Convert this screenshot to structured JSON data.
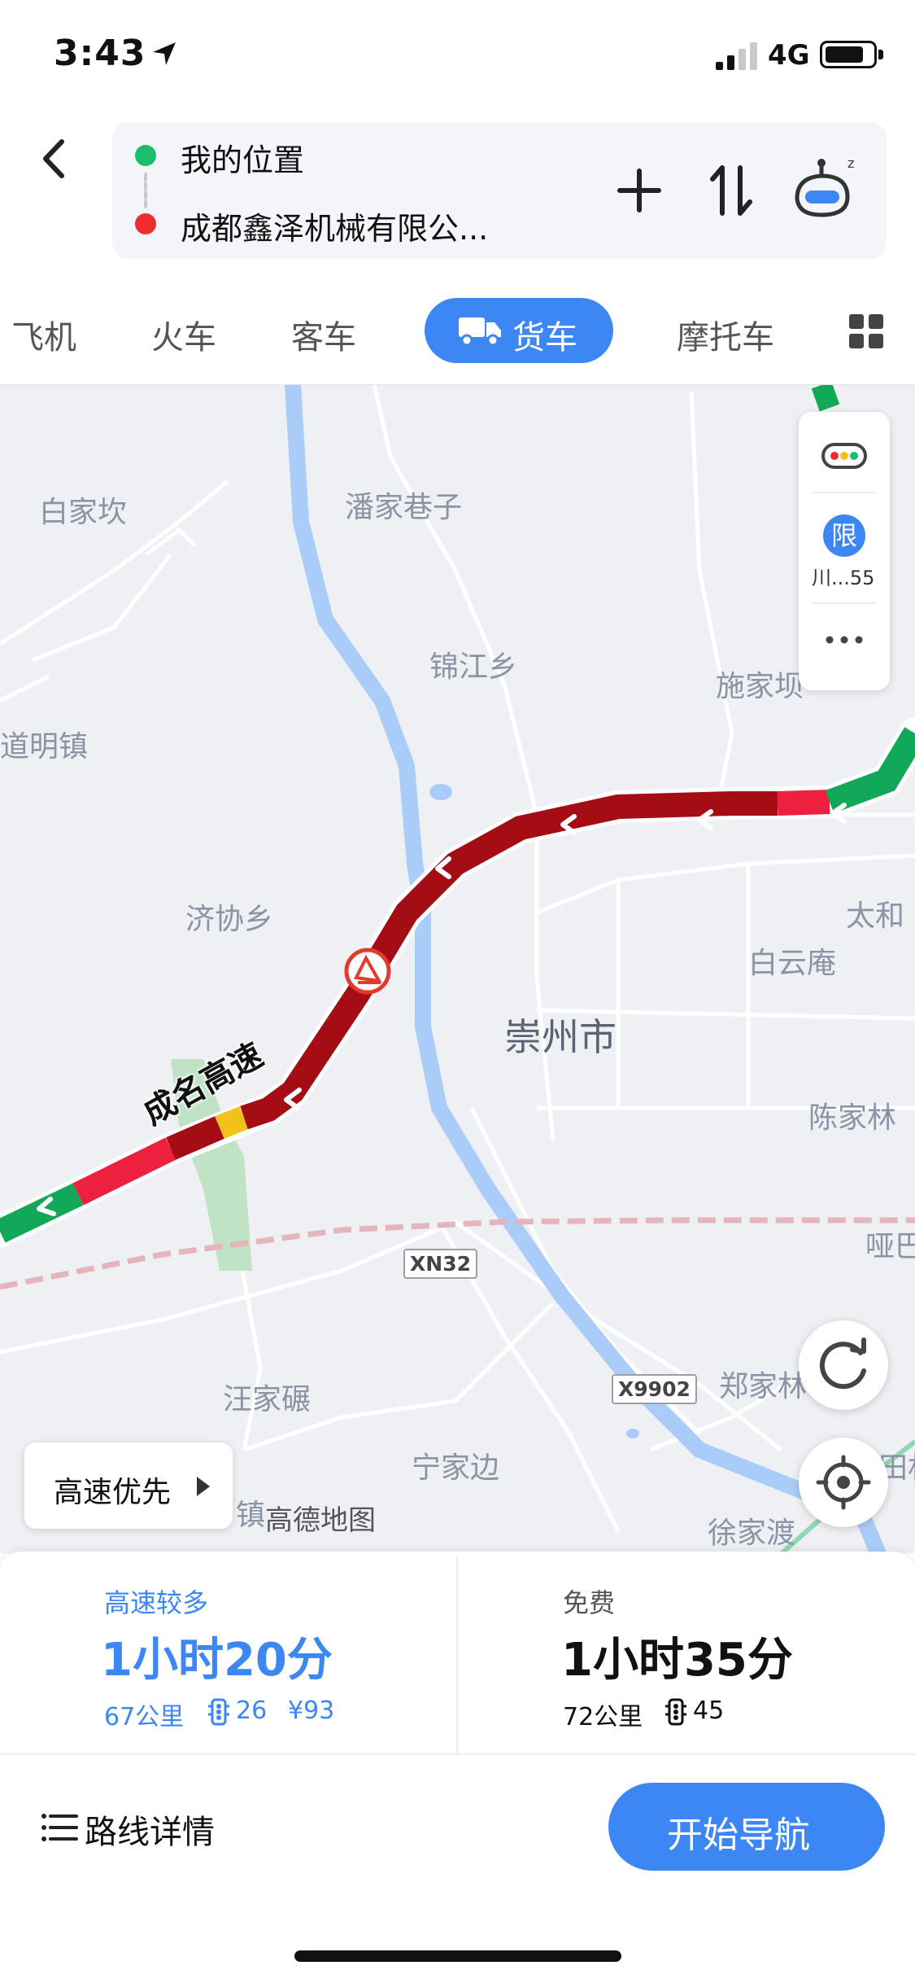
{
  "status_bar": {
    "time": "3:43",
    "network": "4G"
  },
  "route": {
    "origin": "我的位置",
    "destination": "成都鑫泽机械有限公..."
  },
  "tabs": [
    {
      "label": "飞机"
    },
    {
      "label": "火车"
    },
    {
      "label": "客车"
    },
    {
      "label": "货车",
      "active": true
    },
    {
      "label": "摩托车"
    }
  ],
  "map": {
    "places": [
      "白家坎",
      "潘家巷子",
      "锦江乡",
      "施家坝",
      "道明镇",
      "济协乡",
      "太和",
      "白云庵",
      "陈家林",
      "哑巴",
      "汪家碾",
      "宁家边",
      "郑家林",
      "徐家渡",
      "镇",
      "田村"
    ],
    "city": "崇州市",
    "roads": [
      "XN32",
      "X9902"
    ],
    "highway_name": "成名高速",
    "restriction_badge": "限",
    "plate": "川...55",
    "route_pref": "高速优先",
    "watermark": "高德地图"
  },
  "options": [
    {
      "tag": "高速较多",
      "time": "1小时20分",
      "distance": "67公里",
      "lights": "26",
      "fee": "¥93",
      "color": "#3c87f4"
    },
    {
      "tag": "免费",
      "time": "1小时35分",
      "distance": "72公里",
      "lights": "45",
      "color": "#111111"
    }
  ],
  "details_label": "路线详情",
  "start_label": "开始导航",
  "colors": {
    "accent": "#3c87f4",
    "jam": "#a50d14",
    "slow": "#ee2040",
    "clear": "#12a85a",
    "river": "#a9cdf8"
  }
}
